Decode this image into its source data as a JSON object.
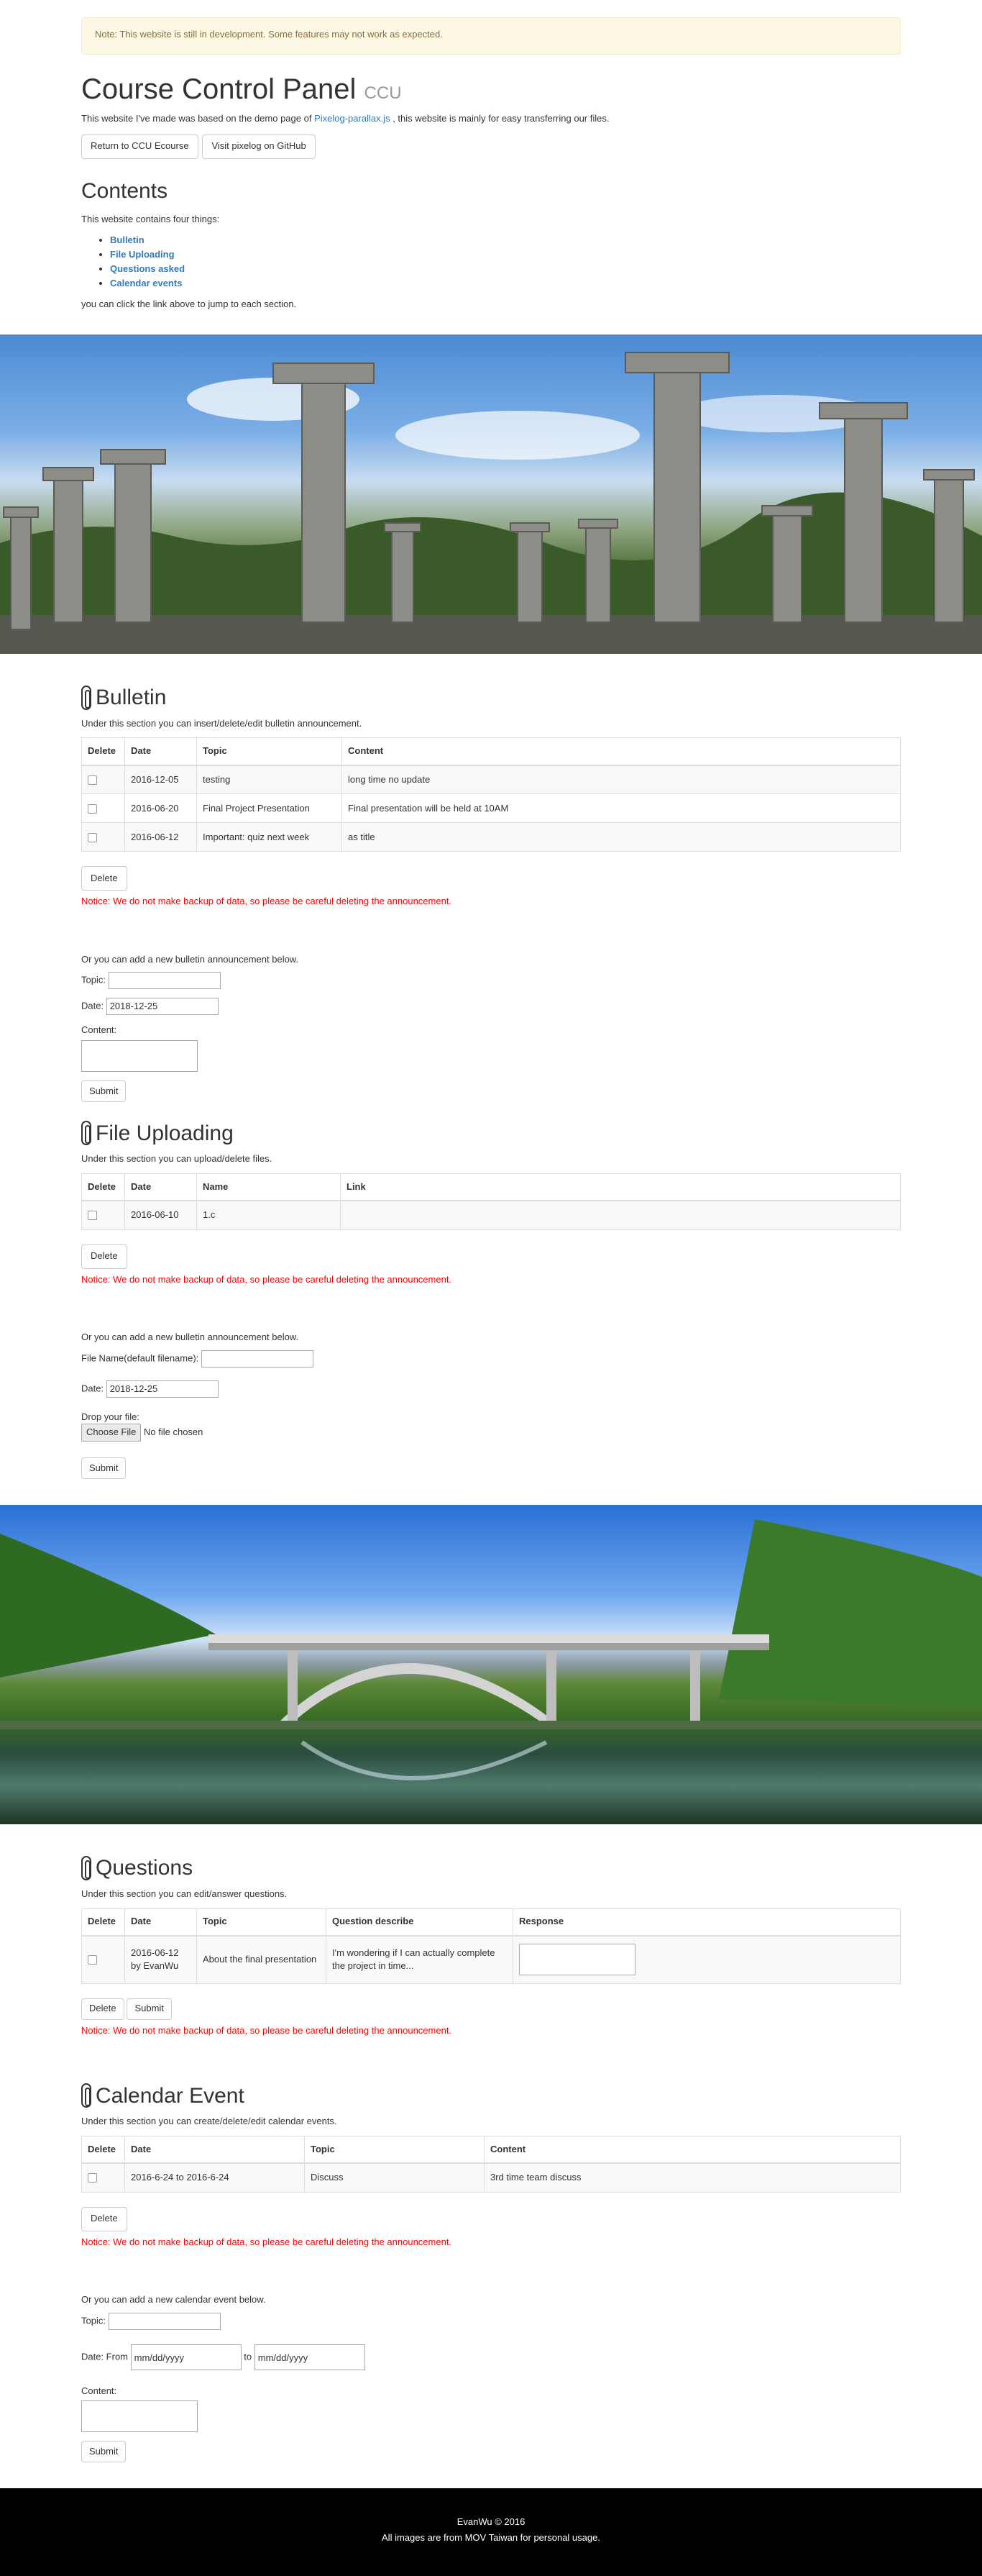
{
  "alert": "Note: This website is still in development. Some features may not work as expected.",
  "header": {
    "title": "Course Control Panel",
    "subtitle": "CCU",
    "intro_before": "This website I've made was based on the demo page of",
    "intro_link": "Pixelog-parallax.js",
    "intro_after": ", this website is mainly for easy transferring our files.",
    "btn_return": "Return to CCU Ecourse",
    "btn_github": "Visit pixelog on GitHub"
  },
  "contents": {
    "title": "Contents",
    "intro": "This website contains four things:",
    "items": [
      "Bulletin",
      "File Uploading",
      "Questions asked",
      "Calendar events"
    ],
    "outro": "you can click the link above to jump to each section."
  },
  "notice": "Notice: We do not make backup of data, so please be careful deleting the announcement.",
  "bulletin": {
    "title": "Bulletin",
    "desc": "Under this section you can insert/delete/edit bulletin announcement.",
    "columns": [
      "Delete",
      "Date",
      "Topic",
      "Content"
    ],
    "rows": [
      {
        "date": "2016-12-05",
        "topic": "testing",
        "content": "long time no update"
      },
      {
        "date": "2016-06-20",
        "topic": "Final Project Presentation",
        "content": "Final presentation will be held at 10AM"
      },
      {
        "date": "2016-06-12",
        "topic": "Important: quiz next week",
        "content": "as title"
      }
    ],
    "delete_label": "Delete",
    "form_intro": "Or you can add a new bulletin announcement below.",
    "topic_label": "Topic:",
    "date_label": "Date:",
    "date_value": "2018-12-25",
    "content_label": "Content:",
    "submit_label": "Submit"
  },
  "files": {
    "title": "File Uploading",
    "desc": "Under this section you can upload/delete files.",
    "columns": [
      "Delete",
      "Date",
      "Name",
      "Link"
    ],
    "rows": [
      {
        "date": "2016-06-10",
        "name": "1.c",
        "link": ""
      }
    ],
    "delete_label": "Delete",
    "form_intro": "Or you can add a new bulletin announcement below.",
    "name_label": "File Name(default filename):",
    "date_label": "Date:",
    "date_value": "2018-12-25",
    "drop_label": "Drop your file:",
    "choose_label": "Choose File",
    "no_file": "No file chosen",
    "submit_label": "Submit"
  },
  "questions": {
    "title": "Questions",
    "desc": "Under this section you can edit/answer questions.",
    "columns": [
      "Delete",
      "Date",
      "Topic",
      "Question describe",
      "Response"
    ],
    "rows": [
      {
        "date": "2016-06-12",
        "by": "by EvanWu",
        "topic": "About the final presentation",
        "question": "I'm wondering if I can actually complete the project in time..."
      }
    ],
    "delete_label": "Delete",
    "submit_label": "Submit"
  },
  "calendar": {
    "title": "Calendar Event",
    "desc": "Under this section you can create/delete/edit calendar events.",
    "columns": [
      "Delete",
      "Date",
      "Topic",
      "Content"
    ],
    "rows": [
      {
        "date": "2016-6-24 to 2016-6-24",
        "topic": "Discuss",
        "content": "3rd time team discuss"
      }
    ],
    "delete_label": "Delete",
    "form_intro": "Or you can add a new calendar event below.",
    "topic_label": "Topic:",
    "date_from_label": "Date: From",
    "date_placeholder": "mm/dd/yyyy",
    "to_label": "to",
    "content_label": "Content:",
    "submit_label": "Submit"
  },
  "footer": {
    "line1": "EvanWu © 2016",
    "line2": "All images are from MOV Taiwan for personal usage."
  }
}
